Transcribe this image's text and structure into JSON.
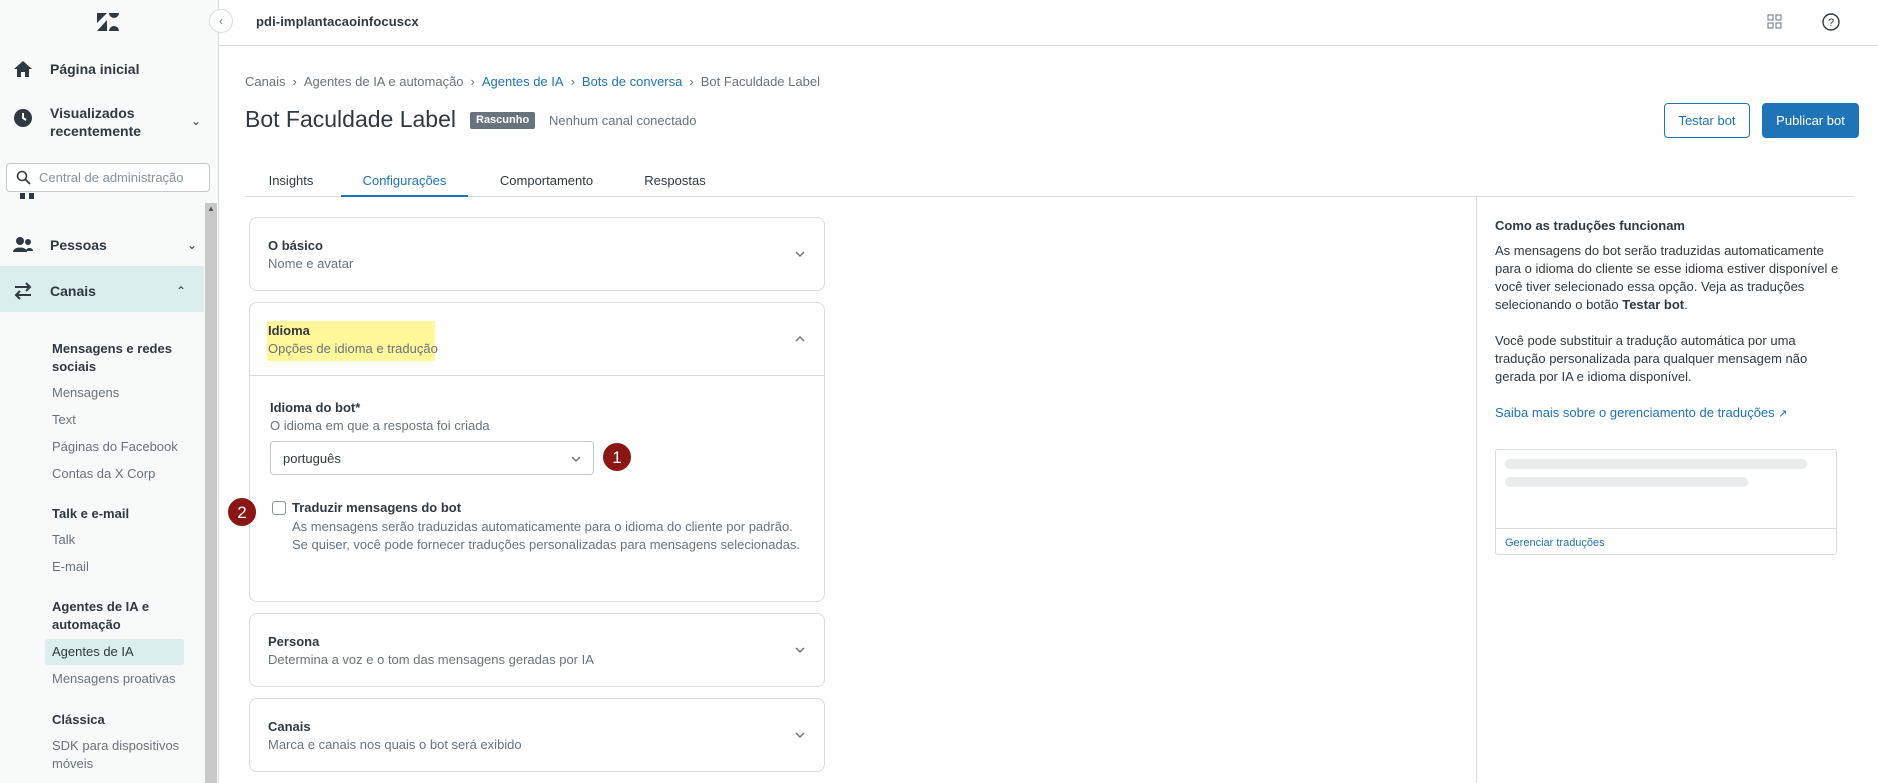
{
  "sidebar": {
    "home_label": "Página inicial",
    "recent_label": "Visualizados recentemente",
    "search_placeholder": "Central de administração",
    "people_label": "Pessoas",
    "channels_label": "Canais",
    "sections": [
      {
        "heading": "Mensagens e redes sociais",
        "links": [
          "Mensagens",
          "Text",
          "Páginas do Facebook",
          "Contas da X Corp"
        ]
      },
      {
        "heading": "Talk e e-mail",
        "links": [
          "Talk",
          "E-mail"
        ]
      },
      {
        "heading": "Agentes de IA e automação",
        "links": [
          "Agentes de IA",
          "Mensagens proativas"
        ]
      },
      {
        "heading": "Clássica",
        "links": [
          "SDK para dispositivos móveis"
        ]
      }
    ]
  },
  "topbar": {
    "subdomain": "pdi-implantacaoinfocuscx"
  },
  "breadcrumb": {
    "items": [
      "Canais",
      "Agentes de IA e automação",
      "Agentes de IA",
      "Bots de conversa",
      "Bot Faculdade Label"
    ]
  },
  "header": {
    "title": "Bot Faculdade Label",
    "status_badge": "Rascunho",
    "channel_status": "Nenhum canal conectado",
    "test_button": "Testar bot",
    "publish_button": "Publicar bot"
  },
  "tabs": [
    "Insights",
    "Configurações",
    "Comportamento",
    "Respostas"
  ],
  "active_tab": "Configurações",
  "cards": {
    "basic": {
      "title": "O básico",
      "subtitle": "Nome e avatar"
    },
    "language": {
      "title": "Idioma",
      "subtitle": "Opções de idioma e tradução"
    },
    "persona": {
      "title": "Persona",
      "subtitle": "Determina a voz e o tom das mensagens geradas por IA"
    },
    "channels": {
      "title": "Canais",
      "subtitle": "Marca e canais nos quais o bot será exibido"
    }
  },
  "language_form": {
    "label": "Idioma do bot*",
    "hint": "O idioma em que a resposta foi criada",
    "selected": "português",
    "translate_label": "Traduzir mensagens do bot",
    "translate_desc": "As mensagens serão traduzidas automaticamente para o idioma do cliente por padrão. Se quiser, você pode fornecer traduções personalizadas para mensagens selecionadas.",
    "translate_checked": false
  },
  "step_badges": [
    "1",
    "2"
  ],
  "right_panel": {
    "title": "Como as traduções funcionam",
    "p1_start": "As mensagens do bot serão traduzidas automaticamente para o idioma do cliente se esse idioma estiver disponível e você tiver selecionado essa opção. Veja as traduções selecionando o botão ",
    "p1_bold": "Testar bot",
    "p1_end": ".",
    "p2": "Você pode substituir a tradução automática por uma tradução personalizada para qualquer mensagem não gerada por IA e idioma disponível.",
    "link": "Saiba mais sobre o gerenciamento de traduções",
    "manage_link": "Gerenciar traduções"
  },
  "colors": {
    "accent": "#1f73b7",
    "badge": "#8a1616",
    "highlight": "#fff799",
    "active_bg": "#dcedee"
  }
}
